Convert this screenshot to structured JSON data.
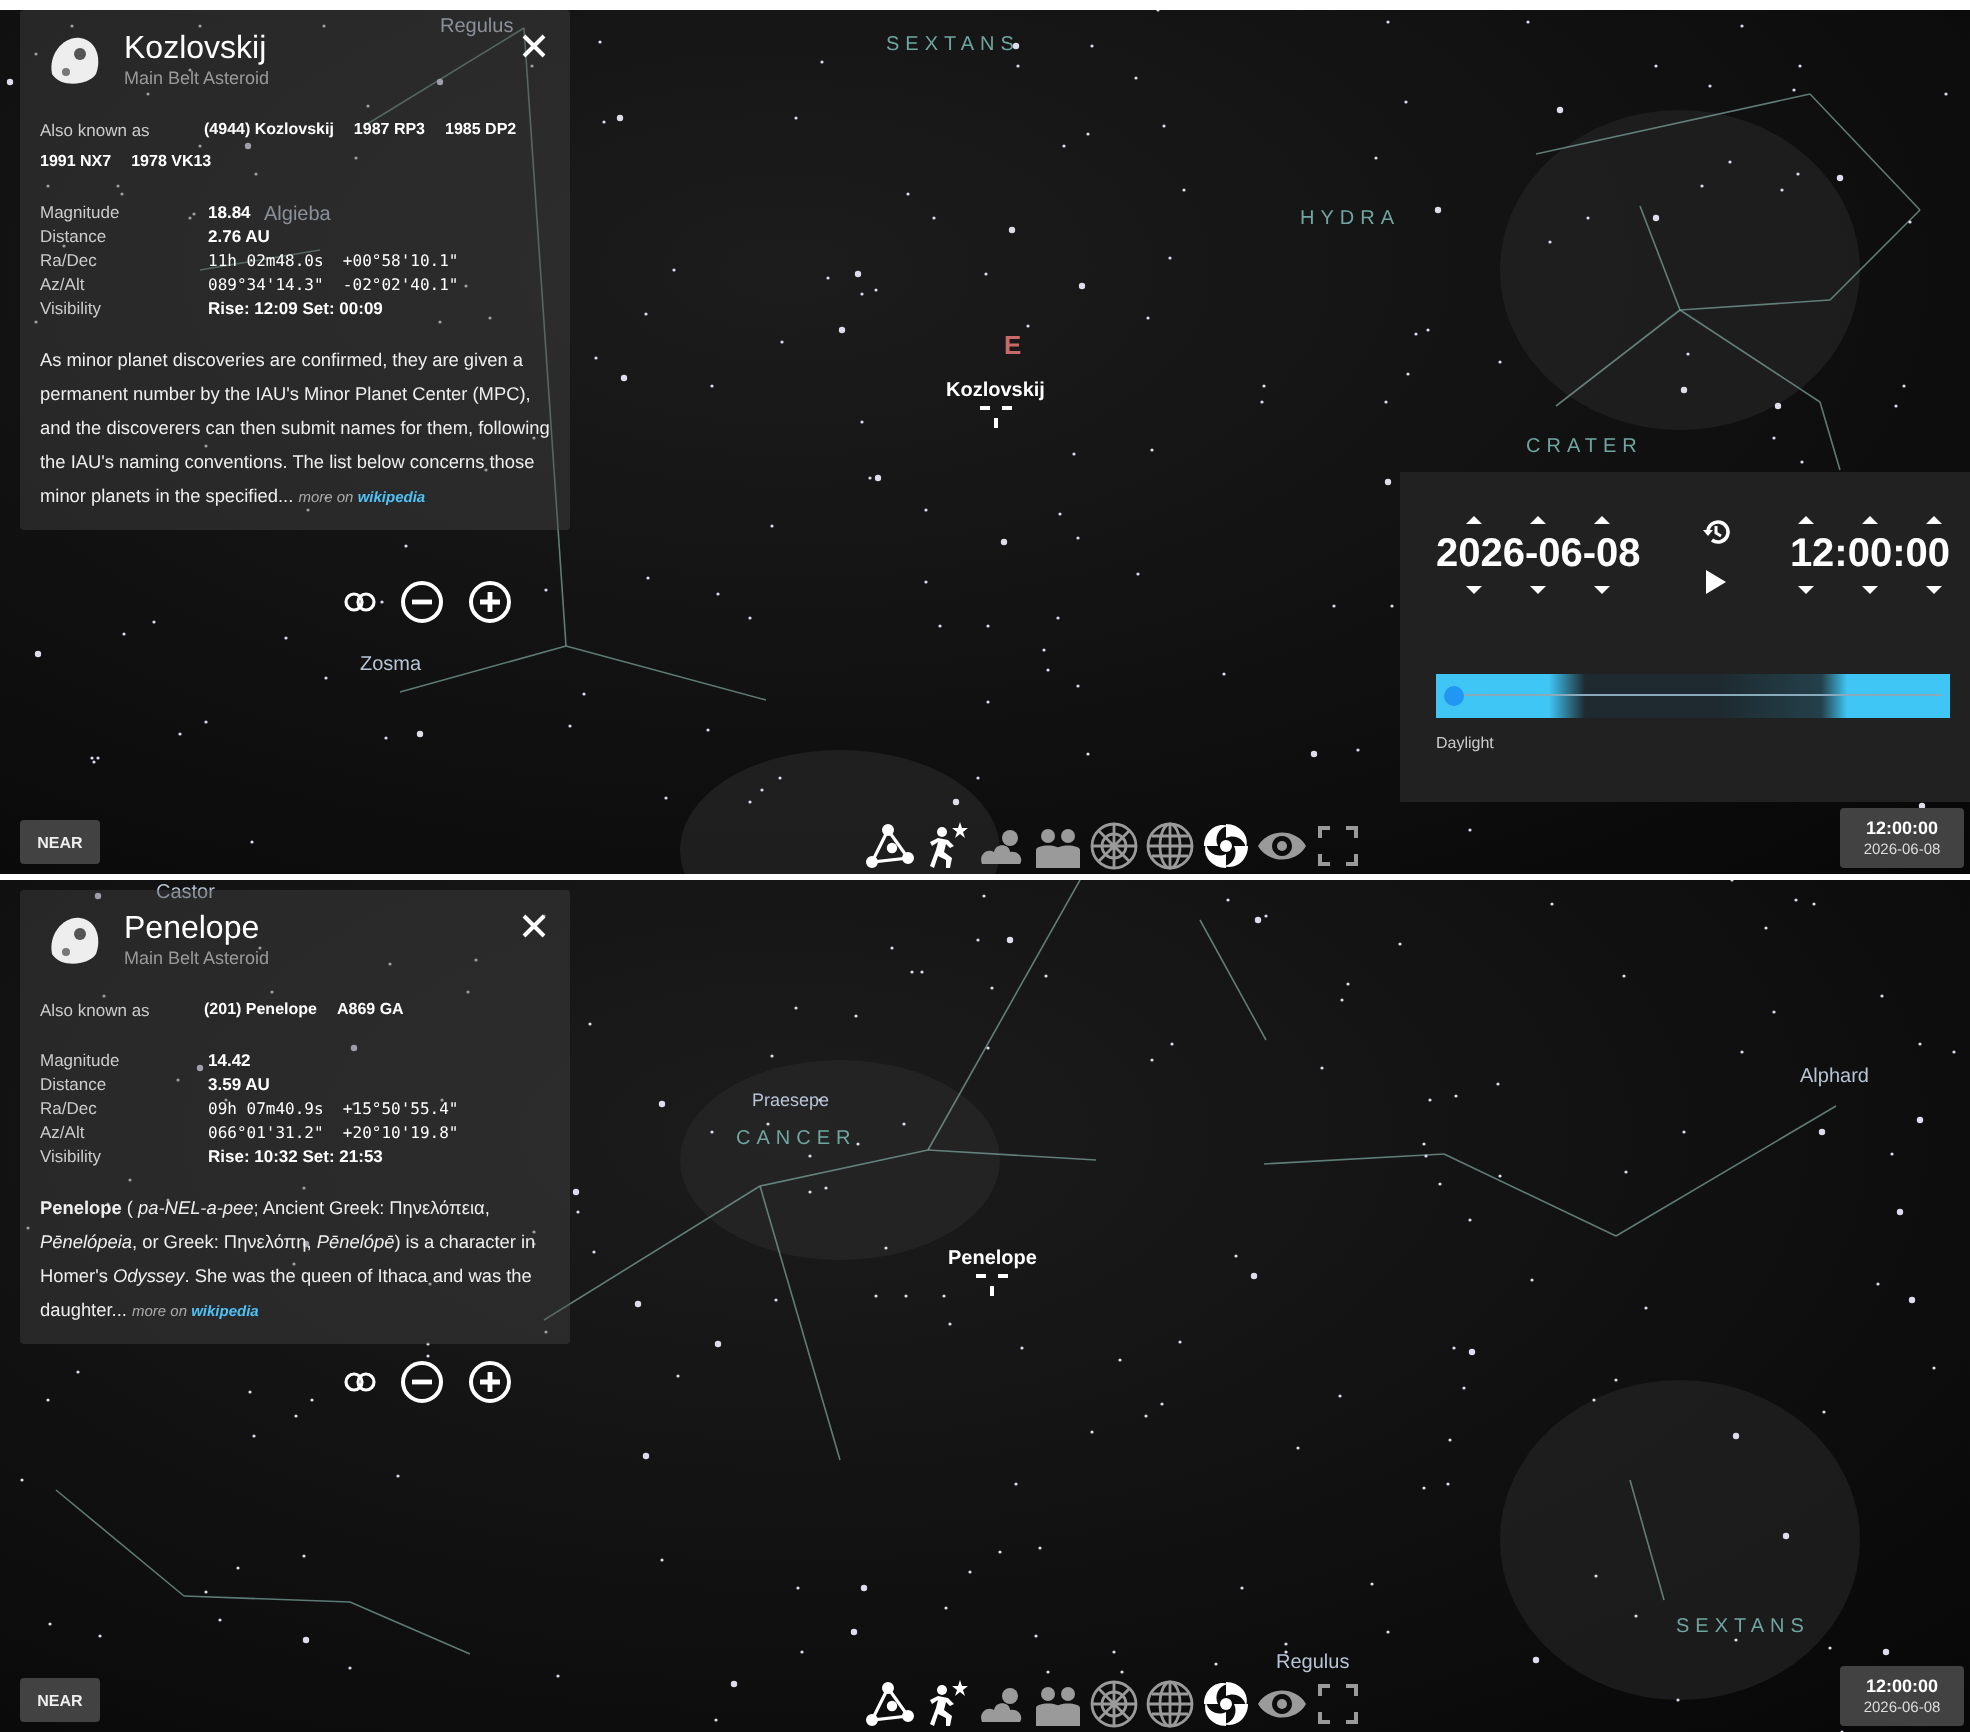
{
  "panes": [
    {
      "info_panel": {
        "name": "Kozlovskij",
        "type": "Main Belt Asteroid",
        "aka_label": "Also known as",
        "aka": [
          "(4944) Kozlovskij",
          "1987 RP3",
          "1985 DP2",
          "1991 NX7",
          "1978 VK13"
        ],
        "rows": [
          {
            "label": "Magnitude",
            "value": "18.84",
            "mono": false
          },
          {
            "label": "Distance",
            "value": "2.76 AU",
            "mono": false
          },
          {
            "label": "Ra/Dec",
            "value": "11h 02m48.0s  +00°58'10.1\"",
            "mono": true
          },
          {
            "label": "Az/Alt",
            "value": "089°34'14.3\"  -02°02'40.1\"",
            "mono": true
          },
          {
            "label": "Visibility",
            "value": "Rise: 12:09   Set: 00:09",
            "mono": false
          }
        ],
        "description": "As minor planet discoveries are confirmed, they are given a permanent number by the IAU's Minor Planet Center (MPC), and the discoverers can then submit names for them, following the IAU's naming conventions. The list below concerns those minor planets in the specified...",
        "more": "more on",
        "link": "wikipedia"
      },
      "sky_labels": [
        {
          "text": "Regulus",
          "kind": "star"
        },
        {
          "text": "Algieba",
          "kind": "star"
        },
        {
          "text": "Zosma",
          "kind": "star"
        },
        {
          "text": "SEXTANS",
          "kind": "constellation"
        },
        {
          "text": "HYDRA",
          "kind": "constellation"
        },
        {
          "text": "CRATER",
          "kind": "constellation"
        },
        {
          "text": "E",
          "kind": "compass"
        },
        {
          "text": "Kozlovskij",
          "kind": "selected"
        }
      ],
      "time_panel": {
        "date": "2026-06-08",
        "time": "12:00:00",
        "daylight": {
          "level": 0.01,
          "label": "Daylight"
        }
      },
      "near_button": "NEAR",
      "toolbar": [
        {
          "kind": "lines",
          "on": true
        },
        {
          "kind": "art",
          "on": true
        },
        {
          "kind": "atmosphere",
          "on": false
        },
        {
          "kind": "landscape",
          "on": false
        },
        {
          "kind": "azgrid",
          "on": false
        },
        {
          "kind": "eqgrid",
          "on": false
        },
        {
          "kind": "dso",
          "on": true
        },
        {
          "kind": "view",
          "on": false
        },
        {
          "kind": "fullscreen",
          "on": false
        }
      ],
      "clock": {
        "time": "12:00:00",
        "date": "2026-06-08"
      }
    },
    {
      "info_panel": {
        "name": "Penelope",
        "type": "Main Belt Asteroid",
        "aka_label": "Also known as",
        "aka": [
          "(201) Penelope",
          "A869 GA"
        ],
        "rows": [
          {
            "label": "Magnitude",
            "value": "14.42",
            "mono": false
          },
          {
            "label": "Distance",
            "value": "3.59 AU",
            "mono": false
          },
          {
            "label": "Ra/Dec",
            "value": "09h 07m40.9s  +15°50'55.4\"",
            "mono": true
          },
          {
            "label": "Az/Alt",
            "value": "066°01'31.2\"  +20°10'19.8\"",
            "mono": true
          },
          {
            "label": "Visibility",
            "value": "Rise: 10:32   Set: 21:53",
            "mono": false
          }
        ],
        "description": "**Penelope** ( *pa-NEL-a-pee*; Ancient Greek: Πηνελόπεια, *Pēnelópeia*, or Greek: Πηνελόπη, *Pēnelópē*) is a character in Homer's *Odyssey*. She was the queen of Ithaca and was the daughter...",
        "more": "more on",
        "link": "wikipedia"
      },
      "sky_labels": [
        {
          "text": "Castor",
          "kind": "star"
        },
        {
          "text": "Praesepe",
          "kind": "cluster"
        },
        {
          "text": "CANCER",
          "kind": "constellation"
        },
        {
          "text": "Alphard",
          "kind": "star"
        },
        {
          "text": "Penelope",
          "kind": "selected"
        },
        {
          "text": "Regulus",
          "kind": "star"
        },
        {
          "text": "SEXTANS",
          "kind": "constellation"
        }
      ],
      "near_button": "NEAR",
      "toolbar": [
        {
          "kind": "lines",
          "on": true
        },
        {
          "kind": "art",
          "on": true
        },
        {
          "kind": "atmosphere",
          "on": false
        },
        {
          "kind": "landscape",
          "on": false
        },
        {
          "kind": "azgrid",
          "on": false
        },
        {
          "kind": "eqgrid",
          "on": false
        },
        {
          "kind": "dso",
          "on": true
        },
        {
          "kind": "view",
          "on": false
        },
        {
          "kind": "fullscreen",
          "on": false
        }
      ],
      "clock": {
        "time": "12:00:00",
        "date": "2026-06-08"
      }
    }
  ]
}
